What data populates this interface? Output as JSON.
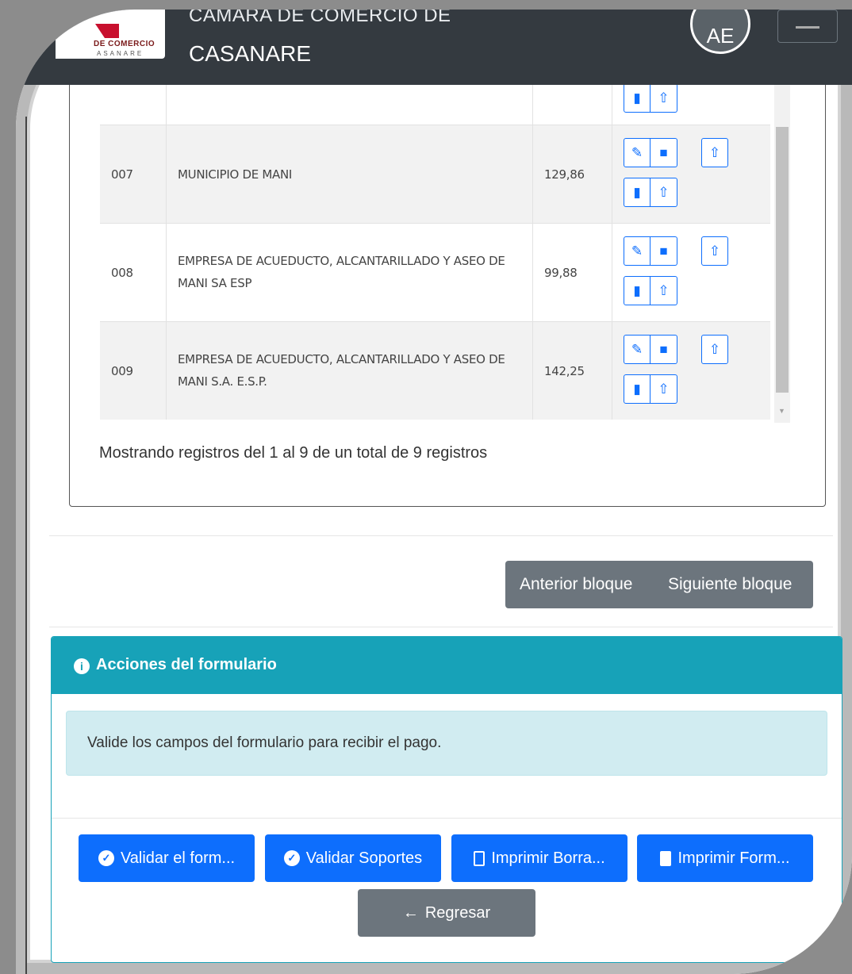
{
  "navbar": {
    "logo_text": "DE COMERCIO",
    "logo_subtext": "ASANARE",
    "brand_line1": "CÁMARA DE COMERCIO DE",
    "brand_line2": "CASANARE",
    "avatar_initials": "AE"
  },
  "table": {
    "rows": [
      {
        "num": "007",
        "name_line1": "MUNICIPIO DE MANI",
        "name_line2": "",
        "value": "129,86"
      },
      {
        "num": "008",
        "name_line1": "EMPRESA DE ACUEDUCTO, ALCANTARILLADO Y ASEO DE",
        "name_line2": "MANI SA ESP",
        "value": "99,88"
      },
      {
        "num": "009",
        "name_line1": "EMPRESA DE ACUEDUCTO, ALCANTARILLADO Y ASEO DE",
        "name_line2": "MANI S.A. E.S.P.",
        "value": "142,25"
      }
    ],
    "info": "Mostrando registros del 1 al 9 de un total de 9 registros"
  },
  "pagination": {
    "prev_label": "Anterior bloque",
    "next_label": "Siguiente bloque"
  },
  "actions": {
    "title": "Acciones del formulario",
    "alert": "Valide los campos del formulario para recibir el pago.",
    "buttons": [
      "Validar el form...",
      "Validar Soportes",
      "Imprimir Borra...",
      "Imprimir Form..."
    ],
    "back_label": "Regresar"
  },
  "colors": {
    "navbar": "#343a40",
    "primary": "#0d6efd",
    "info": "#17a2b8",
    "secondary": "#6c757d"
  }
}
